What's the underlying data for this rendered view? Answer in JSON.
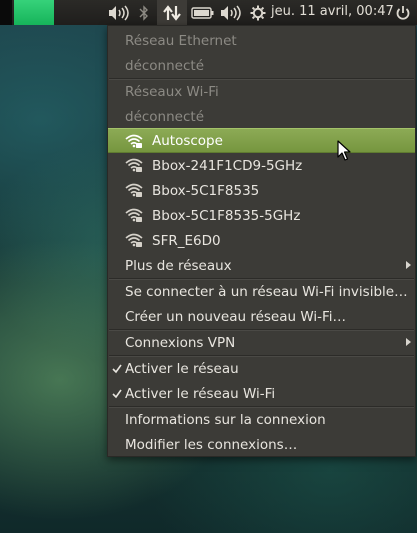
{
  "panel": {
    "clock": "jeu. 11 avril, 00:47",
    "icons": [
      "volume-icon",
      "bluetooth-icon",
      "network-arrows-icon",
      "battery-icon",
      "volume-icon",
      "settings-gear-icon",
      "power-icon"
    ]
  },
  "menu": {
    "ethernet_header": "Réseau Ethernet",
    "ethernet_status": "déconnecté",
    "wifi_header": "Réseaux Wi-Fi",
    "wifi_status": "déconnecté",
    "networks": [
      {
        "name": "Autoscope",
        "highlighted": true
      },
      {
        "name": "Bbox-241F1CD9-5GHz",
        "highlighted": false
      },
      {
        "name": "Bbox-5C1F8535",
        "highlighted": false
      },
      {
        "name": "Bbox-5C1F8535-5GHz",
        "highlighted": false
      },
      {
        "name": "SFR_E6D0",
        "highlighted": false
      }
    ],
    "more_networks": "Plus de réseaux",
    "connect_hidden": "Se connecter à un réseau Wi-Fi invisible…",
    "create_new": "Créer un nouveau réseau Wi-Fi…",
    "vpn": "Connexions VPN",
    "enable_network": "Activer le réseau",
    "enable_wifi": "Activer le réseau Wi-Fi",
    "connection_info": "Informations sur la connexion",
    "edit_connections": "Modifier les connexions…"
  },
  "colors": {
    "highlight": "#7e9e47",
    "menu_bg": "#3c3b37",
    "panel_bg": "#252422"
  }
}
